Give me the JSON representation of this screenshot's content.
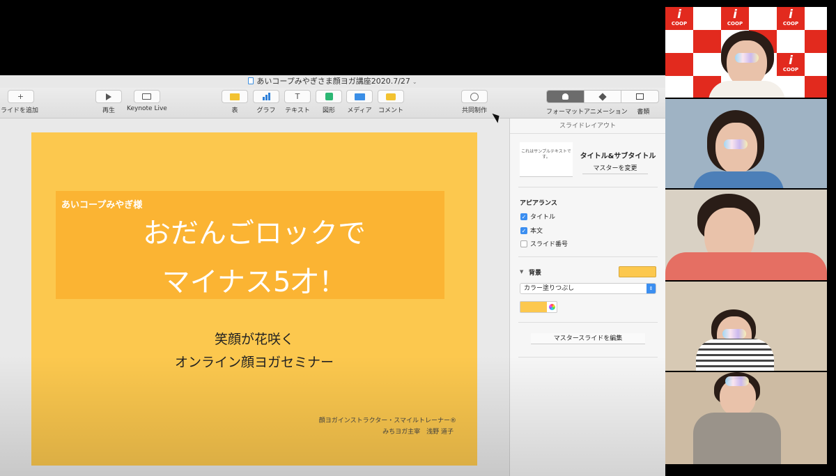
{
  "window": {
    "title": "あいコープみやぎさま顔ヨガ講座2020.7/27"
  },
  "toolbar": {
    "add_slide": "スライドを追加",
    "play": "再生",
    "keynote_live": "Keynote Live",
    "table": "表",
    "chart": "グラフ",
    "text": "テキスト",
    "shape": "図形",
    "media": "メディア",
    "comment": "コメント",
    "collaborate": "共同制作",
    "format": "フォーマット",
    "animate": "アニメーション",
    "document": "書類"
  },
  "slide": {
    "tag": "あいコープみやぎ様",
    "title_line1": "おだんごロックで",
    "title_line2": "マイナス5才！",
    "subtitle_line1": "笑顔が花咲く",
    "subtitle_line2": "オンライン顔ヨガセミナー",
    "credit_line1": "顔ヨガインストラクター・スマイルトレーナー®",
    "credit_line2": "みちヨガ主宰　浅野 道子"
  },
  "inspector": {
    "header": "スライドレイアウト",
    "thumb_text": "これはサンプルテキストです。",
    "layout_name": "タイトル&サブタイトル",
    "change_master": "マスターを変更",
    "appearance_title": "アピアランス",
    "checkbox_title": "タイトル",
    "checkbox_body": "本文",
    "checkbox_slide_number": "スライド番号",
    "background_title": "背景",
    "fill_option": "カラー塗りつぶし",
    "edit_master": "マスタースライドを編集"
  },
  "colors": {
    "slide_background": "#fcc84e",
    "title_box": "#fbb433",
    "coop_red": "#e22a1e",
    "checkbox_blue": "#3b8ef0"
  },
  "logo": {
    "brand_text": "i coop"
  }
}
